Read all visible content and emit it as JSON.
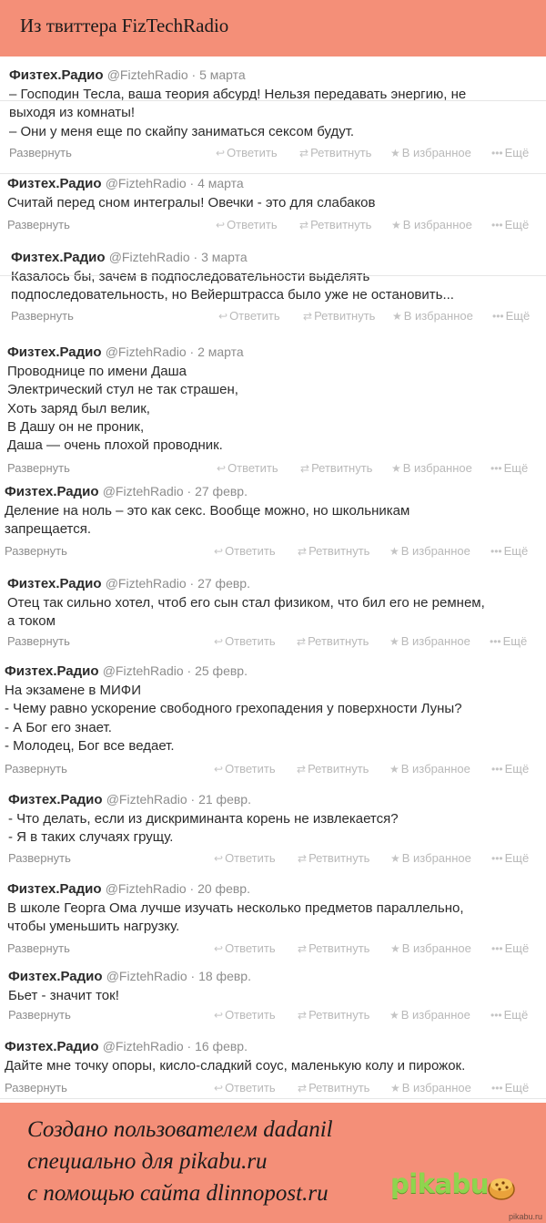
{
  "header": {
    "title": "Из твиттера FizTechRadio"
  },
  "actions": {
    "expand": "Развернуть",
    "reply": "Ответить",
    "retweet": "Ретвитнуть",
    "favorite": "В избранное",
    "more": "Ещё"
  },
  "tweets": [
    {
      "name": "Физтех.Радио",
      "handle": "@FiztehRadio",
      "date": "5 марта",
      "lines": [
        "– Господин Тесла, ваша теория абсурд! Нельзя передавать энергию, не",
        "выходя из комнаты!",
        "– Они у меня еще по скайпу заниматься сексом будут."
      ]
    },
    {
      "name": "Физтех.Радио",
      "handle": "@FiztehRadio",
      "date": "4 марта",
      "lines": [
        "Считай перед сном интегралы! Овечки - это для слабаков"
      ]
    },
    {
      "name": "Физтех.Радио",
      "handle": "@FiztehRadio",
      "date": "3 марта",
      "lines": [
        "Казалось бы, зачем в подпоследовательности выделять",
        "подпоследовательность, но Вейерштрасса было уже не остановить..."
      ]
    },
    {
      "name": "Физтех.Радио",
      "handle": "@FiztehRadio",
      "date": "2 марта",
      "lines": [
        "Проводнице по имени Даша",
        "Электрический стул не так страшен,",
        "Хоть заряд был велик,",
        "В Дашу он не проник,",
        "Даша — очень плохой проводник."
      ]
    },
    {
      "name": "Физтех.Радио",
      "handle": "@FiztehRadio",
      "date": "27 февр.",
      "lines": [
        "Деление на ноль – это как секс. Вообще можно, но школьникам",
        "запрещается."
      ]
    },
    {
      "name": "Физтех.Радио",
      "handle": "@FiztehRadio",
      "date": "27 февр.",
      "lines": [
        "Отец так сильно хотел, чтоб его сын стал физиком, что бил его не ремнем,",
        "а током"
      ]
    },
    {
      "name": "Физтех.Радио",
      "handle": "@FiztehRadio",
      "date": "25 февр.",
      "lines": [
        "На экзамене в МИФИ",
        "- Чему равно ускорение свободного грехопадения у поверхности Луны?",
        "- А Бог его знает.",
        "- Молодец, Бог все ведает."
      ]
    },
    {
      "name": "Физтех.Радио",
      "handle": "@FiztehRadio",
      "date": "21 февр.",
      "lines": [
        "- Что делать, если из дискриминанта корень не извлекается?",
        "- Я в таких случаях грущу."
      ]
    },
    {
      "name": "Физтех.Радио",
      "handle": "@FiztehRadio",
      "date": "20 февр.",
      "lines": [
        "В школе Георга Ома лучше изучать несколько предметов параллельно,",
        "чтобы уменьшить нагрузку."
      ]
    },
    {
      "name": "Физтех.Радио",
      "handle": "@FiztehRadio",
      "date": "18 февр.",
      "lines": [
        "Бьет - значит ток!"
      ]
    },
    {
      "name": "Физтех.Радио",
      "handle": "@FiztehRadio",
      "date": "16 февр.",
      "lines": [
        "Дайте мне точку опоры, кисло-сладкий соус, маленькую колу и пирожок."
      ]
    }
  ],
  "footer": {
    "lines": [
      "Создано пользователем dadanil",
      "специально для pikabu.ru",
      "с помощью сайта dlinnopost.ru"
    ],
    "logo_text": "pikabu",
    "watermark": "pikabu.ru"
  },
  "colors": {
    "background": "#f48f78",
    "feed": "#ffffff",
    "logo": "#8fd44e"
  }
}
